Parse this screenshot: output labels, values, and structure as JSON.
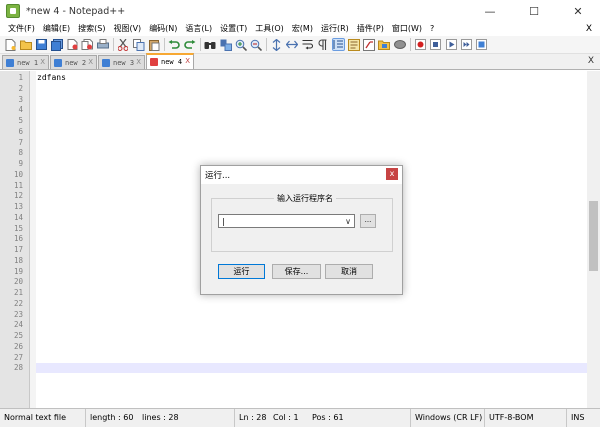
{
  "window": {
    "title": "*new 4 - Notepad++",
    "minimize": "—",
    "maximize": "☐",
    "close": "✕"
  },
  "menu": {
    "items": [
      "文件(F)",
      "编辑(E)",
      "搜索(S)",
      "视图(V)",
      "编码(N)",
      "语言(L)",
      "设置(T)",
      "工具(O)",
      "宏(M)",
      "运行(R)",
      "插件(P)",
      "窗口(W)",
      "?"
    ],
    "close": "X"
  },
  "toolbar": {
    "icons": [
      "new-file-icon",
      "open-file-icon",
      "save-icon",
      "save-all-icon",
      "close-icon",
      "close-all-icon",
      "print-icon",
      "cut-icon",
      "copy-icon",
      "paste-icon",
      "undo-icon",
      "redo-icon",
      "find-icon",
      "replace-icon",
      "zoom-in-icon",
      "zoom-out-icon",
      "sync-vertical-icon",
      "sync-horizontal-icon",
      "word-wrap-icon",
      "show-all-chars-icon",
      "indent-guide-icon",
      "doc-map-icon",
      "function-list-icon",
      "folder-workspace-icon",
      "monitoring-icon",
      "record-macro-icon",
      "stop-macro-icon",
      "play-macro-icon",
      "run-macro-multiple-icon",
      "save-macro-icon"
    ]
  },
  "tabs": [
    {
      "label": "new 1",
      "active": false,
      "modified": false
    },
    {
      "label": "new 2",
      "active": false,
      "modified": false
    },
    {
      "label": "new 3",
      "active": false,
      "modified": false
    },
    {
      "label": "new 4",
      "active": true,
      "modified": true
    }
  ],
  "tab_close": "X",
  "tabbar_close": "X",
  "editor": {
    "line_numbers": [
      "1",
      "2",
      "3",
      "4",
      "5",
      "6",
      "7",
      "8",
      "9",
      "10",
      "11",
      "12",
      "13",
      "14",
      "15",
      "16",
      "17",
      "18",
      "19",
      "20",
      "21",
      "22",
      "23",
      "24",
      "25",
      "26",
      "27",
      "28"
    ],
    "first_line_text": "zdfans"
  },
  "dialog": {
    "title": "运行...",
    "close": "x",
    "group_label": "输入运行程序名",
    "input_value": "|",
    "dropdown_arrow": "∨",
    "browse": "...",
    "run_button": "运行",
    "save_button": "保存...",
    "cancel_button": "取消"
  },
  "status": {
    "file_type": "Normal text file",
    "length": "length : 60",
    "lines": "lines : 28",
    "ln": "Ln : 28",
    "col": "Col : 1",
    "pos": "Pos : 61",
    "eol": "Windows (CR LF)",
    "encoding": "UTF-8-BOM",
    "mode": "INS"
  },
  "colors": {
    "active_tab_accent": "#f7a833",
    "current_line": "#e8e8ff",
    "dialog_close": "#c74444"
  }
}
